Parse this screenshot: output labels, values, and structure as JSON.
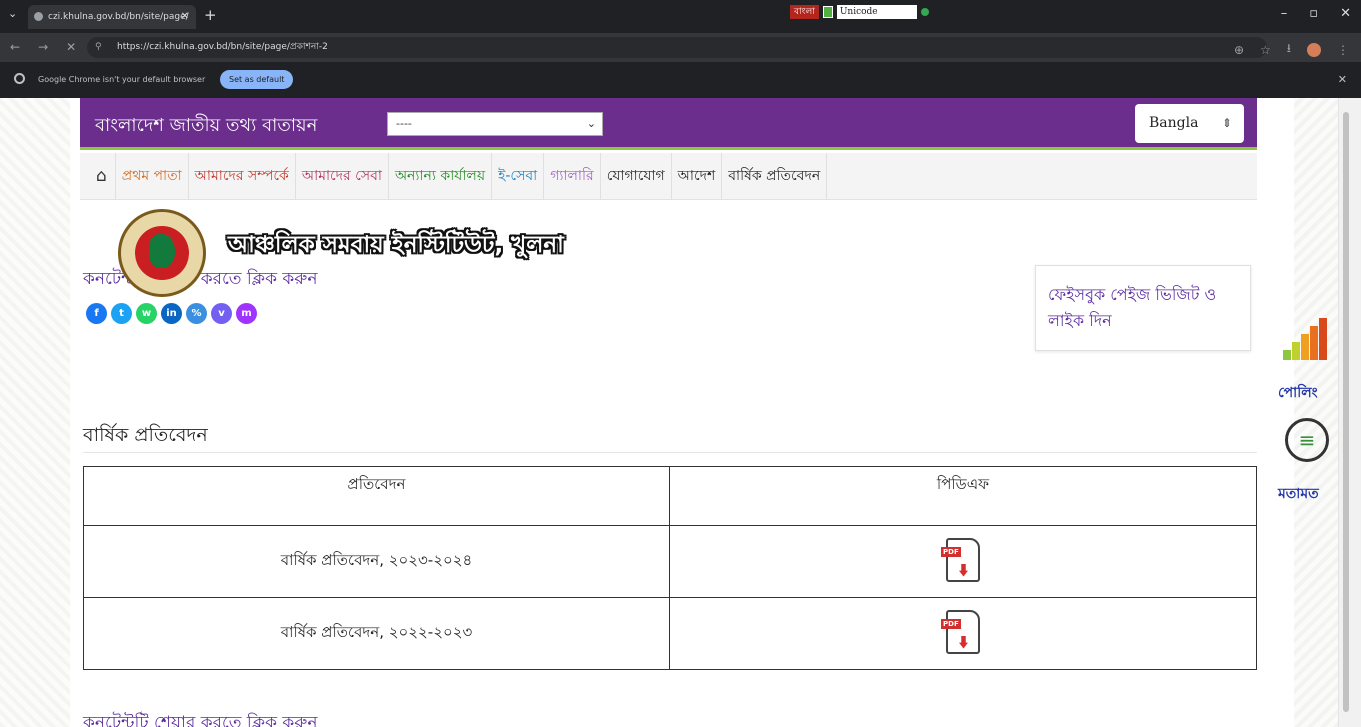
{
  "browser": {
    "tab_title": "czi.khulna.gov.bd/bn/site/page/",
    "url": "https://czi.khulna.gov.bd/bn/site/page/প্রকাশনা-2",
    "extension_label": "বাংলা",
    "extension_select": "Unicode",
    "infobar_message": "Google Chrome isn't your default browser",
    "infobar_button": "Set as default"
  },
  "site": {
    "portal_title": "বাংলাদেশ জাতীয় তথ্য বাতায়ন",
    "office_select": "----",
    "language": "Bangla"
  },
  "menu": [
    {
      "label": "প্রথম পাতা",
      "color": "#d2691e"
    },
    {
      "label": "আমাদের সম্পর্কে",
      "color": "#c0392b"
    },
    {
      "label": "আমাদের সেবা",
      "color": "#b03060"
    },
    {
      "label": "অন্যান্য কার্যালয়",
      "color": "#228b22"
    },
    {
      "label": "ই-সেবা",
      "color": "#1a7fbf"
    },
    {
      "label": "গ্যালারি",
      "color": "#a060c0"
    },
    {
      "label": "যোগাযোগ",
      "color": "#222222"
    },
    {
      "label": "আদেশ",
      "color": "#222222"
    },
    {
      "label": "বার্ষিক প্রতিবেদন",
      "color": "#222222"
    }
  ],
  "institute_name": "আঞ্চলিক সমবায় ইনস্টিটিউট, খুলনা",
  "share_text": "কনটেন্টটি শেয়ার করতে ক্লিক করুন",
  "social_icons": [
    {
      "name": "facebook",
      "glyph": "f",
      "color": "#1877f2"
    },
    {
      "name": "twitter",
      "glyph": "t",
      "color": "#1da1f2"
    },
    {
      "name": "whatsapp",
      "glyph": "w",
      "color": "#25d366"
    },
    {
      "name": "linkedin",
      "glyph": "in",
      "color": "#0a66c2"
    },
    {
      "name": "copy-link",
      "glyph": "%",
      "color": "#3b8fe0"
    },
    {
      "name": "viber",
      "glyph": "v",
      "color": "#7360f2"
    },
    {
      "name": "messenger",
      "glyph": "m",
      "color": "#a033ff"
    }
  ],
  "facebook_box": "ফেইসবুক পেইজ ভিজিট ও লাইক দিন",
  "side_widgets": {
    "poll_label": "পোলিং",
    "feedback_label": "মতামত"
  },
  "section_title": "বার্ষিক প্রতিবেদন",
  "table": {
    "headers": [
      "প্রতিবেদন",
      "পিডিএফ"
    ],
    "rows": [
      {
        "title": "বার্ষিক প্রতিবেদন, ২০২৩-২০২৪",
        "pdf_badge": "PDF"
      },
      {
        "title": "বার্ষিক প্রতিবেদন, ২০২২-২০২৩",
        "pdf_badge": "PDF"
      }
    ]
  },
  "bottom_link": "কনটেন্টটি শেয়ার করতে ক্লিক করুন",
  "colors": {
    "header_bg": "#6b2e8d",
    "header_border": "#8dc63f",
    "link": "#5b2ca0",
    "side_label": "#2538a8"
  }
}
